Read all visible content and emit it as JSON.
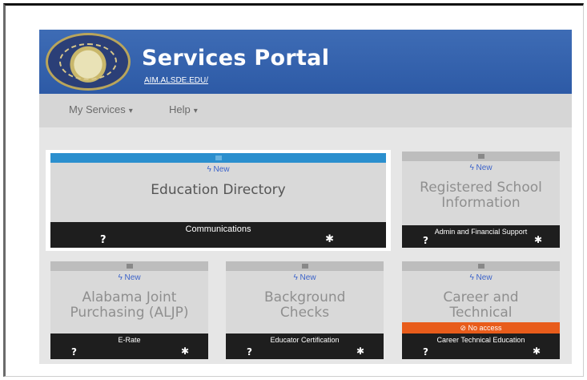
{
  "header": {
    "title": "Services Portal",
    "link": "AIM.ALSDE.EDU/"
  },
  "nav": {
    "my_services": "My Services",
    "help": "Help",
    "caret": "▾"
  },
  "icons": {
    "lightning": "ϟ",
    "help": "?",
    "gear": "✱",
    "no_access": "⊘"
  },
  "tiles": [
    {
      "badge": "New",
      "name": "Education Directory",
      "category": "Communications"
    },
    {
      "badge": "New",
      "name": "Registered School Information",
      "category": "Admin and Financial Support"
    },
    {
      "badge": "New",
      "name": "Alabama Joint Purchasing (ALJP)",
      "category": "E-Rate"
    },
    {
      "badge": "New",
      "name": "Background Checks",
      "category": "Educator Certification"
    },
    {
      "badge": "New",
      "name": "Career and Technical",
      "category": "Career Technical Education",
      "status": "No access"
    }
  ],
  "colors": {
    "banner": "#2d5aa6",
    "featured_grip": "#2b8fce",
    "footer": "#1e1e1e",
    "no_access": "#e85c1b",
    "new_badge": "#3c63c9"
  }
}
